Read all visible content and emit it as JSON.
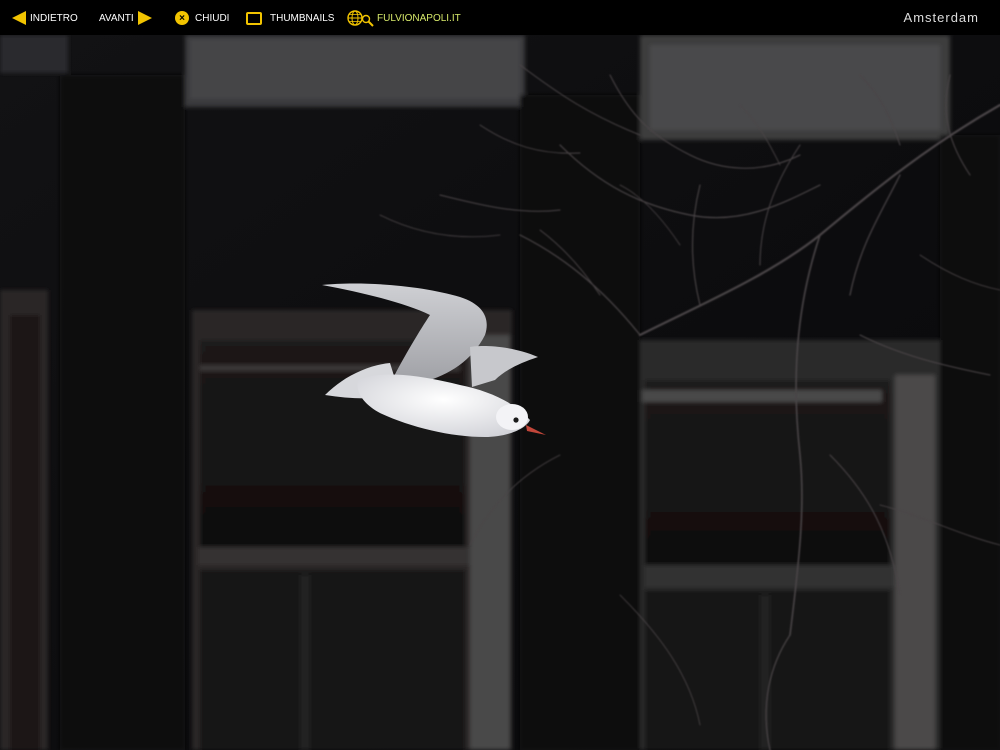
{
  "nav": {
    "back_label": "INDIETRO",
    "next_label": "AVANTI",
    "close_label": "CHIUDI",
    "thumbnails_label": "THUMBNAILS",
    "site_label": "FULVIONAPOLI.IT"
  },
  "gallery": {
    "title": "Amsterdam"
  },
  "colors": {
    "accent": "#f2c400",
    "site_link": "#d6e86a",
    "background": "#000000"
  },
  "icons": {
    "back": "arrow-left-icon",
    "next": "arrow-right-icon",
    "close": "close-circle-icon",
    "thumbnails": "thumbnails-square-icon",
    "site": "globe-search-icon"
  }
}
